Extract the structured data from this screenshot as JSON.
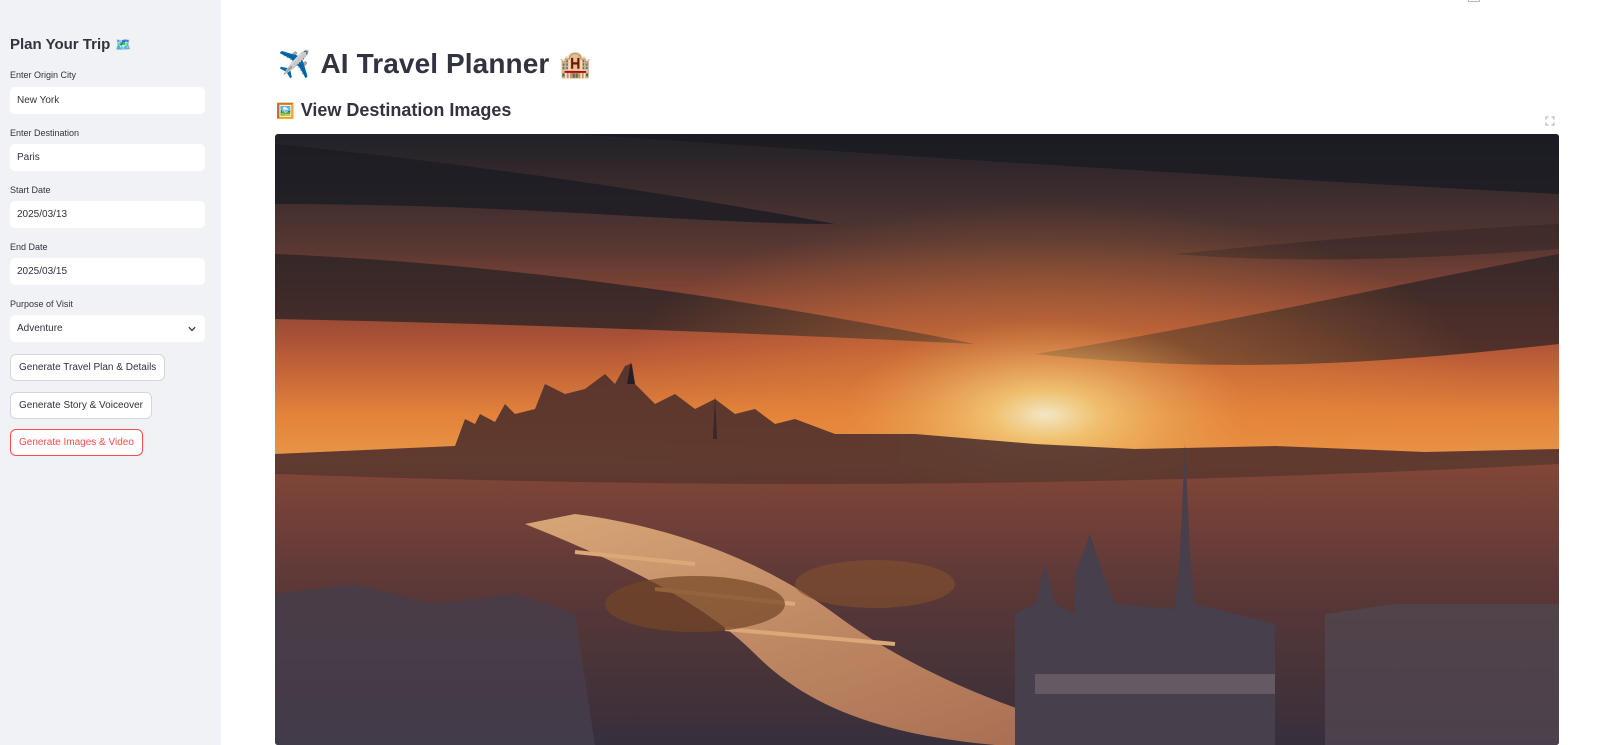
{
  "sidebar": {
    "title": "Plan Your Trip",
    "title_emoji": "🗺️",
    "origin": {
      "label": "Enter Origin City",
      "value": "New York"
    },
    "destination": {
      "label": "Enter Destination",
      "value": "Paris"
    },
    "start_date": {
      "label": "Start Date",
      "value": "2025/03/13"
    },
    "end_date": {
      "label": "End Date",
      "value": "2025/03/15"
    },
    "purpose": {
      "label": "Purpose of Visit",
      "value": "Adventure"
    },
    "buttons": {
      "plan": "Generate Travel Plan & Details",
      "story": "Generate Story & Voiceover",
      "images": "Generate Images & Video"
    }
  },
  "main": {
    "title": "AI Travel Planner",
    "title_icon_left": "✈️",
    "title_icon_right": "🏨",
    "section_title": "View Destination Images",
    "section_icon": "🖼️",
    "image_icon": "paris-sunset-skyline-image"
  },
  "colors": {
    "accent": "#ff4b4b",
    "sidebar_bg": "#f0f2f6"
  }
}
